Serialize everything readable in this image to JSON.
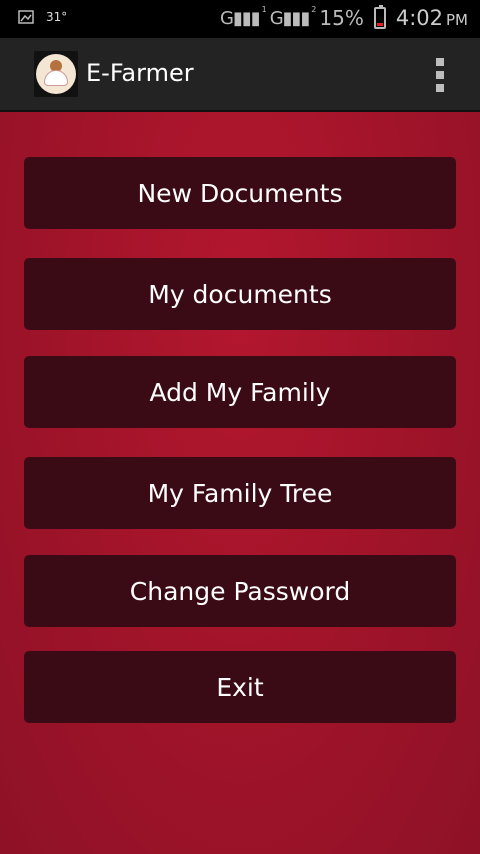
{
  "status_bar": {
    "temperature": "31°",
    "network1": "G",
    "network1_sim": "1",
    "network2": "G",
    "network2_sim": "2",
    "battery_percent": "15%",
    "battery_level": 0.15,
    "time": "4:02",
    "ampm": "PM"
  },
  "app_bar": {
    "title": "E-Farmer",
    "logo_icon": "farmer-logo-icon",
    "menu_icon": "overflow-menu-icon"
  },
  "menu": {
    "items": [
      {
        "label": "New Documents"
      },
      {
        "label": "My documents"
      },
      {
        "label": "Add My Family"
      },
      {
        "label": "My Family Tree"
      },
      {
        "label": "Change Password"
      },
      {
        "label": "Exit"
      }
    ]
  },
  "colors": {
    "background": "#a3142a",
    "button": "#3b0b15",
    "action_bar": "#232323"
  }
}
